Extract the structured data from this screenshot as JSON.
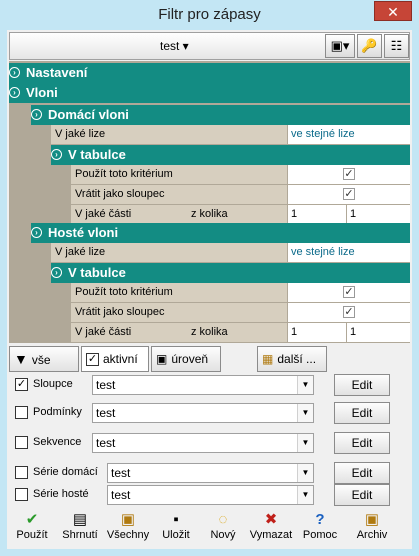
{
  "window": {
    "title": "Filtr pro zápasy",
    "close": "✕"
  },
  "toolbar": {
    "dropdown_label": "test ▾",
    "btn1": "▣▾",
    "btn2": "🔑",
    "btn3": "☷"
  },
  "tree": {
    "nastaveni": "Nastavení",
    "vloni": "Vloni",
    "domaci": "Domácí vloni",
    "hoste": "Hosté vloni",
    "v_tabulce": "V tabulce",
    "v_jake_lize": "V jaké lize",
    "ve_stejne_lize": "ve stejné lize",
    "pouzit": "Použít toto kritérium",
    "vratit": "Vrátit jako sloupec",
    "v_jake_casti": "V jaké části",
    "z_kolika": "z kolika",
    "one": "1",
    "check": "✓"
  },
  "filter_tabs": {
    "vse": "vše",
    "aktivni": "aktivní",
    "uroven": "úroveň",
    "dalsi": "další ..."
  },
  "rows": [
    {
      "label": "Sloupce",
      "value": "test",
      "checked": "✓"
    },
    {
      "label": "Podmínky",
      "value": "test",
      "checked": ""
    },
    {
      "label": "Sekvence",
      "value": "test",
      "checked": ""
    },
    {
      "label": "Série domácí",
      "value": "test",
      "checked": ""
    },
    {
      "label": "Série hosté",
      "value": "test",
      "checked": ""
    }
  ],
  "edit_label": "Edit",
  "bottom": [
    {
      "label": "Použít",
      "icon": "✔"
    },
    {
      "label": "Shrnutí",
      "icon": "▤"
    },
    {
      "label": "Všechny",
      "icon": "▣"
    },
    {
      "label": "Uložit",
      "icon": "▪"
    },
    {
      "label": "Nový",
      "icon": "◌"
    },
    {
      "label": "Vymazat",
      "icon": "✖"
    },
    {
      "label": "Pomoc",
      "icon": "?"
    },
    {
      "label": "Archiv",
      "icon": "▣"
    }
  ]
}
